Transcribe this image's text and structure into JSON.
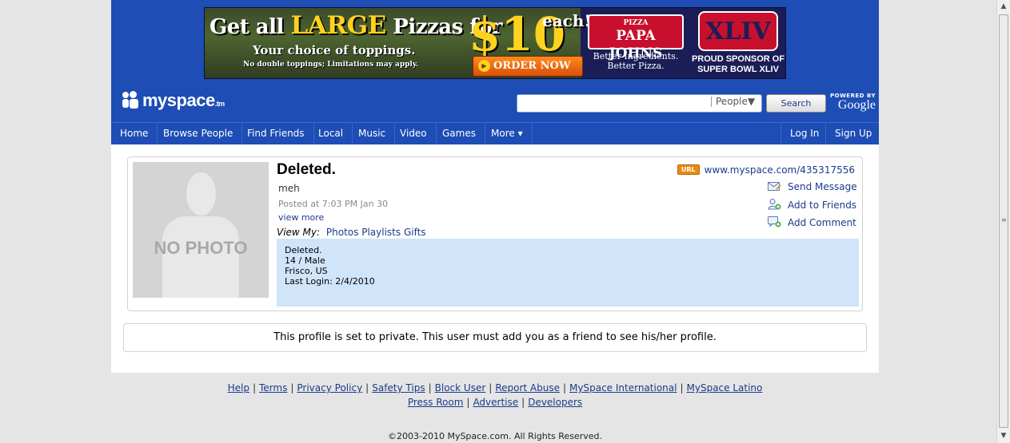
{
  "ad": {
    "line1_a": "Get all",
    "line1_big": "LARGE",
    "line1_b": "Pizzas for",
    "price": "$10",
    "each": "each!",
    "line2": "Your choice of toppings.",
    "line3": "No double toppings; Limitations may apply.",
    "order_button": "ORDER NOW",
    "pj_top": "PIZZA",
    "pj_brand": "PAPA JOHNS",
    "pj_tagline1": "Better Ingredients.",
    "pj_tagline2": "Better Pizza.",
    "sb_numeral": "XLIV",
    "sb_sponsor1": "PROUD SPONSOR OF",
    "sb_sponsor2": "SUPER BOWL XLIV"
  },
  "header": {
    "logo": "myspace",
    "logo_tm": ".tm",
    "search_placeholder": "",
    "search_type": "People▼",
    "search_button": "Search",
    "powered_by": "POWERED BY",
    "google": "Google"
  },
  "nav": {
    "items": [
      "Home",
      "Browse People",
      "Find Friends",
      "Local",
      "Music",
      "Video",
      "Games",
      "More ▾"
    ],
    "login": "Log In",
    "signup": "Sign Up"
  },
  "profile": {
    "photo_text": "NO PHOTO",
    "name": "Deleted.",
    "headline": "meh",
    "posted": "Posted at 7:03 PM Jan 30",
    "view_more": "view more",
    "view_my_label": "View My:",
    "view_my_links": [
      "Photos",
      "Playlists",
      "Gifts"
    ],
    "url_badge": "URL",
    "url": "www.myspace.com/435317556",
    "actions": [
      "Send Message",
      "Add to Friends",
      "Add Comment"
    ],
    "details": {
      "name": "Deleted.",
      "age_gender": "14 / Male",
      "location": "Frisco, US",
      "last_login": "Last Login: 2/4/2010"
    }
  },
  "private_notice": "This profile is set to private. This user must add you as a friend to see his/her profile.",
  "footer": {
    "row1": [
      "Help",
      "Terms",
      "Privacy Policy",
      "Safety Tips",
      "Block User",
      "Report Abuse",
      "MySpace International",
      "MySpace Latino"
    ],
    "row2": [
      "Press Room",
      "Advertise",
      "Developers"
    ],
    "separator": "|",
    "copyright": "©2003-2010 MySpace.com. All Rights Reserved."
  },
  "colors": {
    "brand_blue": "#1d4db5",
    "details_bg": "#d0e4fa",
    "link": "#1c3a8a"
  }
}
